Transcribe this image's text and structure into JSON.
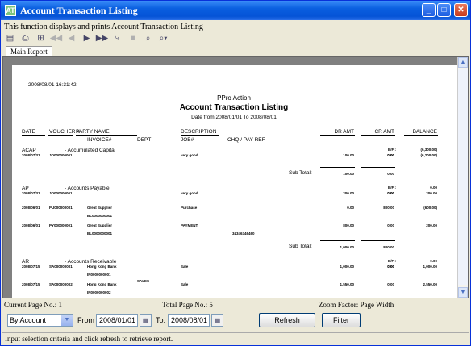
{
  "window": {
    "title": "Account Transaction Listing",
    "app_icon": "AT"
  },
  "description": "This function displays and prints Account Transaction Listing",
  "tabs": [
    {
      "label": "Main Report"
    }
  ],
  "report": {
    "printed_at": "2008/08/01  16:31:42",
    "company": "PPro Action",
    "title": "Account Transaction Listing",
    "date_range": "Date from 2008/01/01  To 2008/08/01",
    "headers": {
      "date": "DATE",
      "voucher": "VOUCHER #",
      "party": "PARTY NAME",
      "invoice": "INVOICE#",
      "dept": "DEPT",
      "description": "DESCRIPTION",
      "job": "JOB#",
      "chq": "CHQ / PAY REF",
      "dr": "DR AMT",
      "cr": "CR AMT",
      "balance": "BALANCE"
    },
    "groups": [
      {
        "code": "ACAP",
        "name": "-   Accumulated Capital",
        "bf_label": "B/F :",
        "bf_cr": "0.00",
        "bf_bal": "(6,300.00)",
        "rows": [
          {
            "date": "2008/07/31",
            "voucher": "JO000000001",
            "party": "",
            "invoice": "",
            "dept": "",
            "desc": "very good",
            "chq": "",
            "dr": "100.00",
            "cr": "0.00",
            "bal": "(6,200.00)"
          }
        ],
        "subtotal_label": "Sub Total:",
        "sub_dr": "100.00",
        "sub_cr": "0.00"
      },
      {
        "code": "AP",
        "name": "-   Accounts Payable",
        "bf_label": "B/F :",
        "bf_cr": "0.00",
        "bf_bal": "0.00",
        "rows": [
          {
            "date": "2008/07/31",
            "voucher": "JO000000001",
            "party": "",
            "invoice": "",
            "dept": "",
            "desc": "very good",
            "chq": "",
            "dr": "200.00",
            "cr": "0.00",
            "bal": "200.00"
          },
          {
            "date": "2008/06/01",
            "voucher": "PU000000001",
            "party": "Great Supplier",
            "invoice": "BL0000000001",
            "dept": "",
            "desc": "Purchase",
            "chq": "",
            "dr": "0.00",
            "cr": "800.00",
            "bal": "(600.00)"
          },
          {
            "date": "2008/06/01",
            "voucher": "PY000000001",
            "party": "Great Supplier",
            "invoice": "BL0000000001",
            "dept": "",
            "desc": "PAYMENT",
            "chq": "34346346460",
            "dr": "800.00",
            "cr": "0.00",
            "bal": "200.00"
          }
        ],
        "subtotal_label": "Sub Total:",
        "sub_dr": "1,000.00",
        "sub_cr": "800.00"
      },
      {
        "code": "AR",
        "name": "-   Accounts Receivable",
        "bf_label": "B/F :",
        "bf_cr": "0.00",
        "bf_bal": "0.00",
        "rows": [
          {
            "date": "2008/07/15",
            "voucher": "SA000000001",
            "party": "Hong Kong Bank",
            "invoice": "IN0000000001",
            "dept": "SALES",
            "desc": "Sale",
            "chq": "",
            "dr": "1,000.00",
            "cr": "0.00",
            "bal": "1,000.00"
          },
          {
            "date": "2008/07/15",
            "voucher": "SA000000002",
            "party": "Hong Kong Bank",
            "invoice": "IN0000000002",
            "dept": "",
            "desc": "Sale",
            "chq": "",
            "dr": "1,550.00",
            "cr": "0.00",
            "bal": "2,550.00"
          },
          {
            "date": "2008/07/15",
            "voucher": "SA000000001",
            "party": "Hong Kong Bank",
            "invoice": "IN0000000002a",
            "dept": "SALES",
            "desc": "Sale",
            "chq": "",
            "dr": "1,000.00",
            "cr": "0.00",
            "bal": "3,550.00"
          }
        ]
      }
    ]
  },
  "status": {
    "current_page": "Current Page No.: 1",
    "total_page": "Total Page No.: 5",
    "zoom": "Zoom Factor: Page Width"
  },
  "controls": {
    "filter_by": "By Account",
    "from_label": "From",
    "from_date": "2008/01/01",
    "to_label": "To:",
    "to_date": "2008/08/01",
    "refresh_label": "Refresh",
    "filter_label": "Filter"
  },
  "hint": "Input selection criteria and click refresh to retrieve report."
}
